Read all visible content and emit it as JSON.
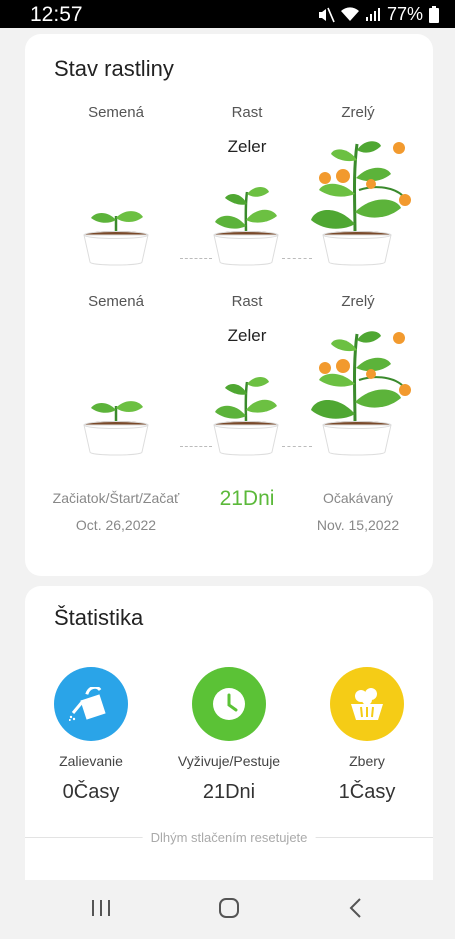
{
  "status": {
    "time": "12:57",
    "battery": "77%"
  },
  "plant_state": {
    "title": "Stav rastliny",
    "stages": [
      "Semená",
      "Rast",
      "Zrelý"
    ],
    "plant_name": "Zeler",
    "start_label": "Začiatok/Štart/Začať",
    "start_date": "Oct. 26,2022",
    "days": "21Dni",
    "expected_label": "Očakávaný",
    "expected_date": "Nov. 15,2022"
  },
  "stats": {
    "title": "Štatistika",
    "items": [
      {
        "label": "Zalievanie",
        "value": "0Časy",
        "icon": "watering-can-icon",
        "color": "#2aa4e8"
      },
      {
        "label": "Vyživuje/Pestuje",
        "value": "21Dni",
        "icon": "clock-icon",
        "color": "#5bc236"
      },
      {
        "label": "Zbery",
        "value": "1Časy",
        "icon": "harvest-basket-icon",
        "color": "#f5cc16"
      }
    ],
    "hint": "Dlhým stlačením resetujete"
  },
  "nav": {
    "recents_icon": "recents-icon",
    "home_icon": "home-icon",
    "back_icon": "back-icon"
  }
}
